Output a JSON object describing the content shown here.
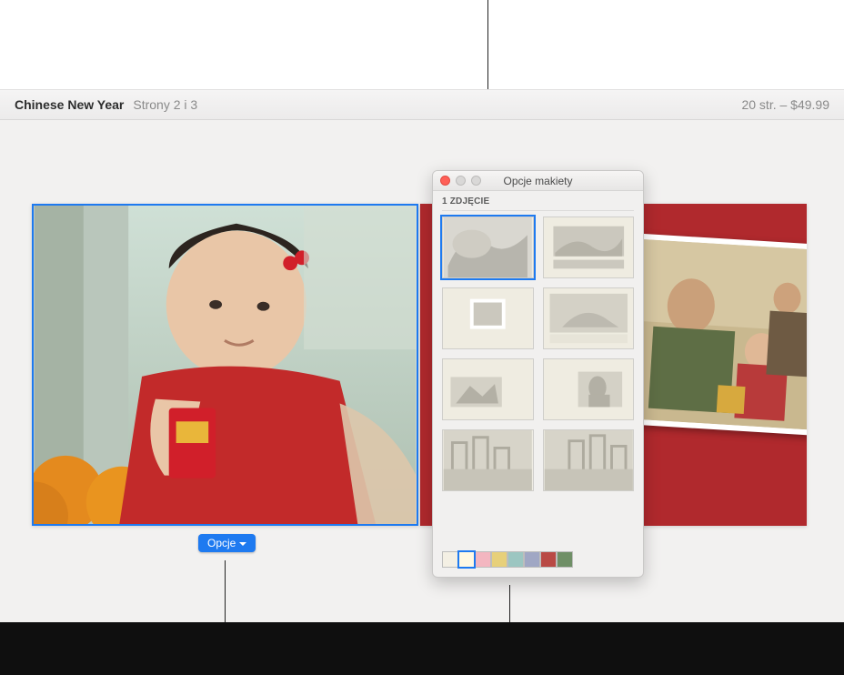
{
  "toolbar": {
    "title": "Chinese New Year",
    "subtitle": "Strony 2 i 3",
    "price": "20 str. – $49.99"
  },
  "opcje_button_label": "Opcje",
  "panel": {
    "title": "Opcje makiety",
    "section_label": "1 ZDJĘCIE"
  },
  "swatches": [
    "#f4f0e4",
    "#fff9e3",
    "#f3b6c0",
    "#e7d07a",
    "#9cc6c1",
    "#a0a7c4",
    "#b94a45",
    "#6f8f66"
  ],
  "callouts": {
    "top": true,
    "bottom_left": true,
    "bottom_right": true
  }
}
